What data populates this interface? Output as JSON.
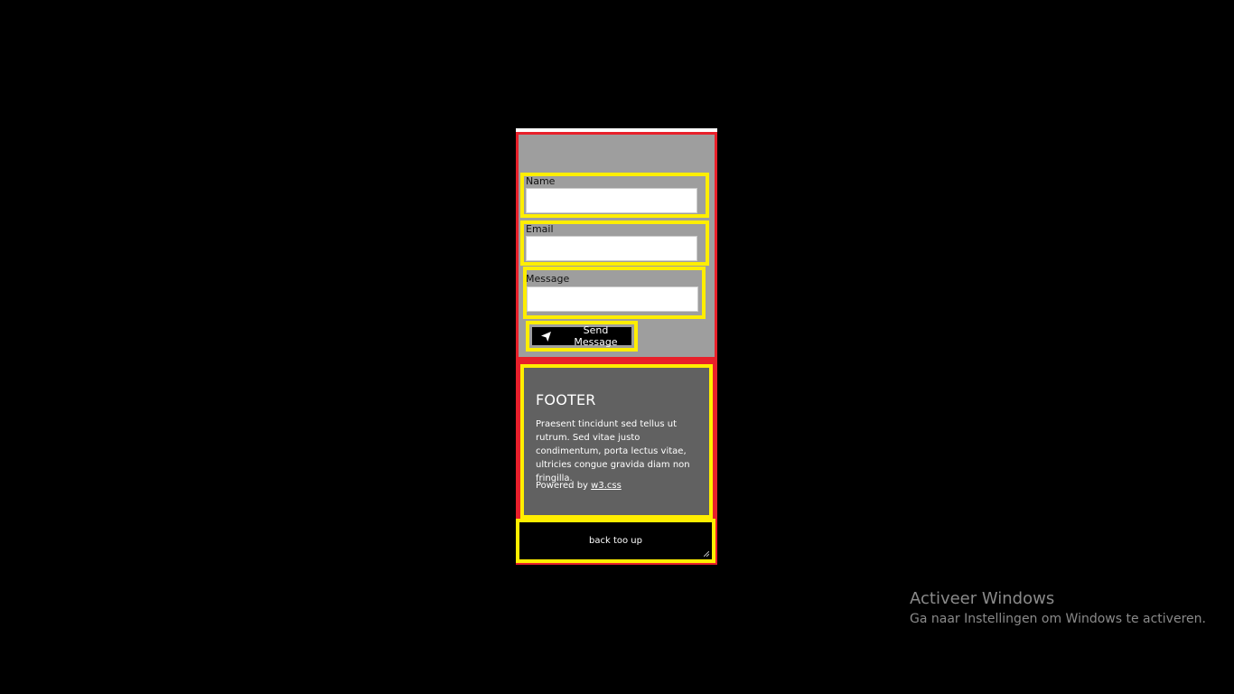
{
  "contact_form": {
    "fields": [
      {
        "label": "Name",
        "value": "",
        "placeholder": ""
      },
      {
        "label": "Email",
        "value": "",
        "placeholder": ""
      },
      {
        "label": "Message",
        "value": "",
        "placeholder": ""
      }
    ],
    "send_button_label": "Send Message",
    "send_icon": "paper-plane-icon"
  },
  "footer": {
    "title": "FOOTER",
    "text": "Praesent tincidunt sed tellus ut rutrum. Sed vitae justo condimentum, porta lectus vitae, ultricies congue gravida diam non fringilla.",
    "powered_prefix": "Powered by",
    "powered_link": "w3.css"
  },
  "back_to_top": {
    "label": "back too up"
  },
  "windows_watermark": {
    "title": "Activeer Windows",
    "subtitle": "Ga naar Instellingen om Windows te activeren."
  },
  "colors": {
    "background": "#000000",
    "outline_red": "#e8202a",
    "outline_yellow": "#ffee00",
    "form_background": "#9e9e9e",
    "footer_background": "#616161"
  }
}
